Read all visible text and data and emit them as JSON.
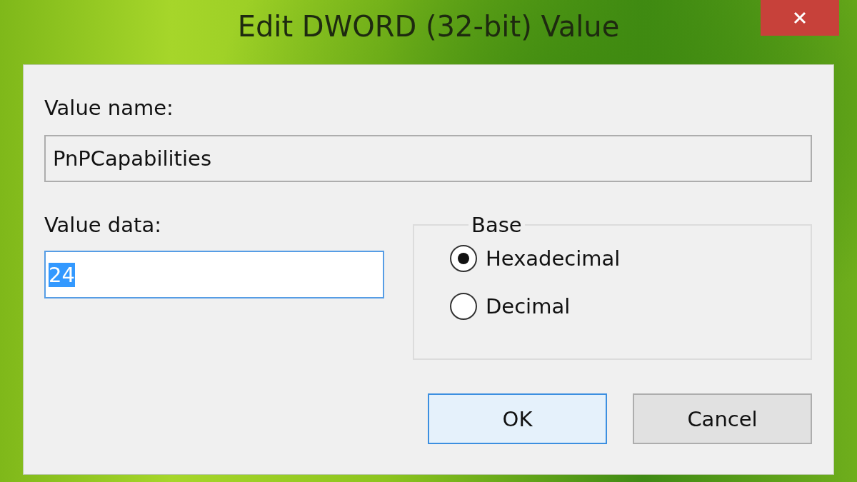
{
  "window": {
    "title": "Edit DWORD (32-bit) Value"
  },
  "value_name": {
    "label": "Value name:",
    "value": "PnPCapabilities"
  },
  "value_data": {
    "label": "Value data:",
    "value": "24",
    "text_selected": true
  },
  "base": {
    "label": "Base",
    "options": [
      {
        "label": "Hexadecimal",
        "selected": true
      },
      {
        "label": "Decimal",
        "selected": false
      }
    ]
  },
  "buttons": [
    {
      "label": "OK",
      "default": true
    },
    {
      "label": "Cancel",
      "default": false
    }
  ]
}
